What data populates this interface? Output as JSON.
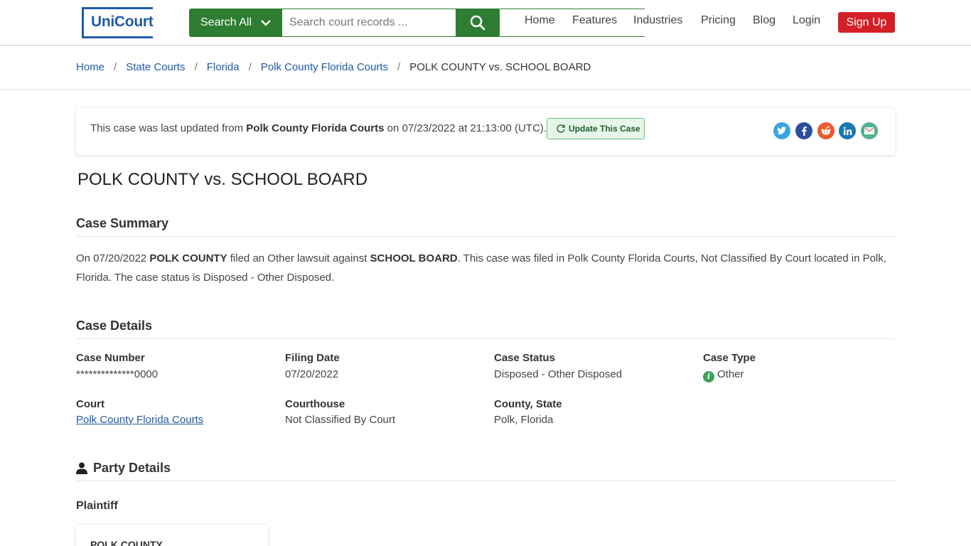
{
  "header": {
    "logo_text": "UniCourt",
    "search_all_label": "Search All",
    "search_placeholder": "Search court records ...",
    "nav": [
      "Home",
      "Features",
      "Industries",
      "Pricing",
      "Blog",
      "Login"
    ],
    "signup_label": "Sign Up"
  },
  "breadcrumb": {
    "items": [
      "Home",
      "State Courts",
      "Florida",
      "Polk County Florida Courts"
    ],
    "current": "POLK COUNTY vs. SCHOOL BOARD",
    "separator": "/"
  },
  "update_notice": {
    "prefix": "This case was last updated from",
    "court": "Polk County Florida Courts",
    "suffix": "on 07/23/2022 at 21:13:00 (UTC).",
    "button_label": "Update This Case"
  },
  "social": [
    {
      "name": "twitter",
      "color": "#3aa3e3",
      "glyph": "t"
    },
    {
      "name": "facebook",
      "color": "#2b4f9e",
      "glyph": "f"
    },
    {
      "name": "reddit",
      "color": "#ec5a2d",
      "glyph": "r"
    },
    {
      "name": "linkedin",
      "color": "#1b76b4",
      "glyph": "in"
    },
    {
      "name": "email",
      "color": "#4fb38f",
      "glyph": "✉"
    }
  ],
  "case_title": "POLK COUNTY vs. SCHOOL BOARD",
  "case_summary": {
    "heading": "Case Summary",
    "t1": "On 07/20/2022 ",
    "plaintiff": "POLK COUNTY",
    "t2": " filed an Other lawsuit against ",
    "defendant": "SCHOOL BOARD",
    "t3": ". This case was filed in Polk County Florida Courts, Not Classified By Court located in Polk, Florida. The case status is Disposed - Other Disposed."
  },
  "case_details": {
    "heading": "Case Details",
    "case_number_label": "Case Number",
    "case_number": "**************0000",
    "filing_date_label": "Filing Date",
    "filing_date": "07/20/2022",
    "case_status_label": "Case Status",
    "case_status": "Disposed - Other Disposed",
    "case_type_label": "Case Type",
    "case_type": "Other",
    "court_label": "Court",
    "court": "Polk County Florida Courts",
    "courthouse_label": "Courthouse",
    "courthouse": "Not Classified By Court",
    "county_state_label": "County, State",
    "county_state": "Polk, Florida"
  },
  "party_details": {
    "heading": "Party Details",
    "plaintiff_label": "Plaintiff",
    "plaintiff_name": "POLK COUNTY"
  }
}
